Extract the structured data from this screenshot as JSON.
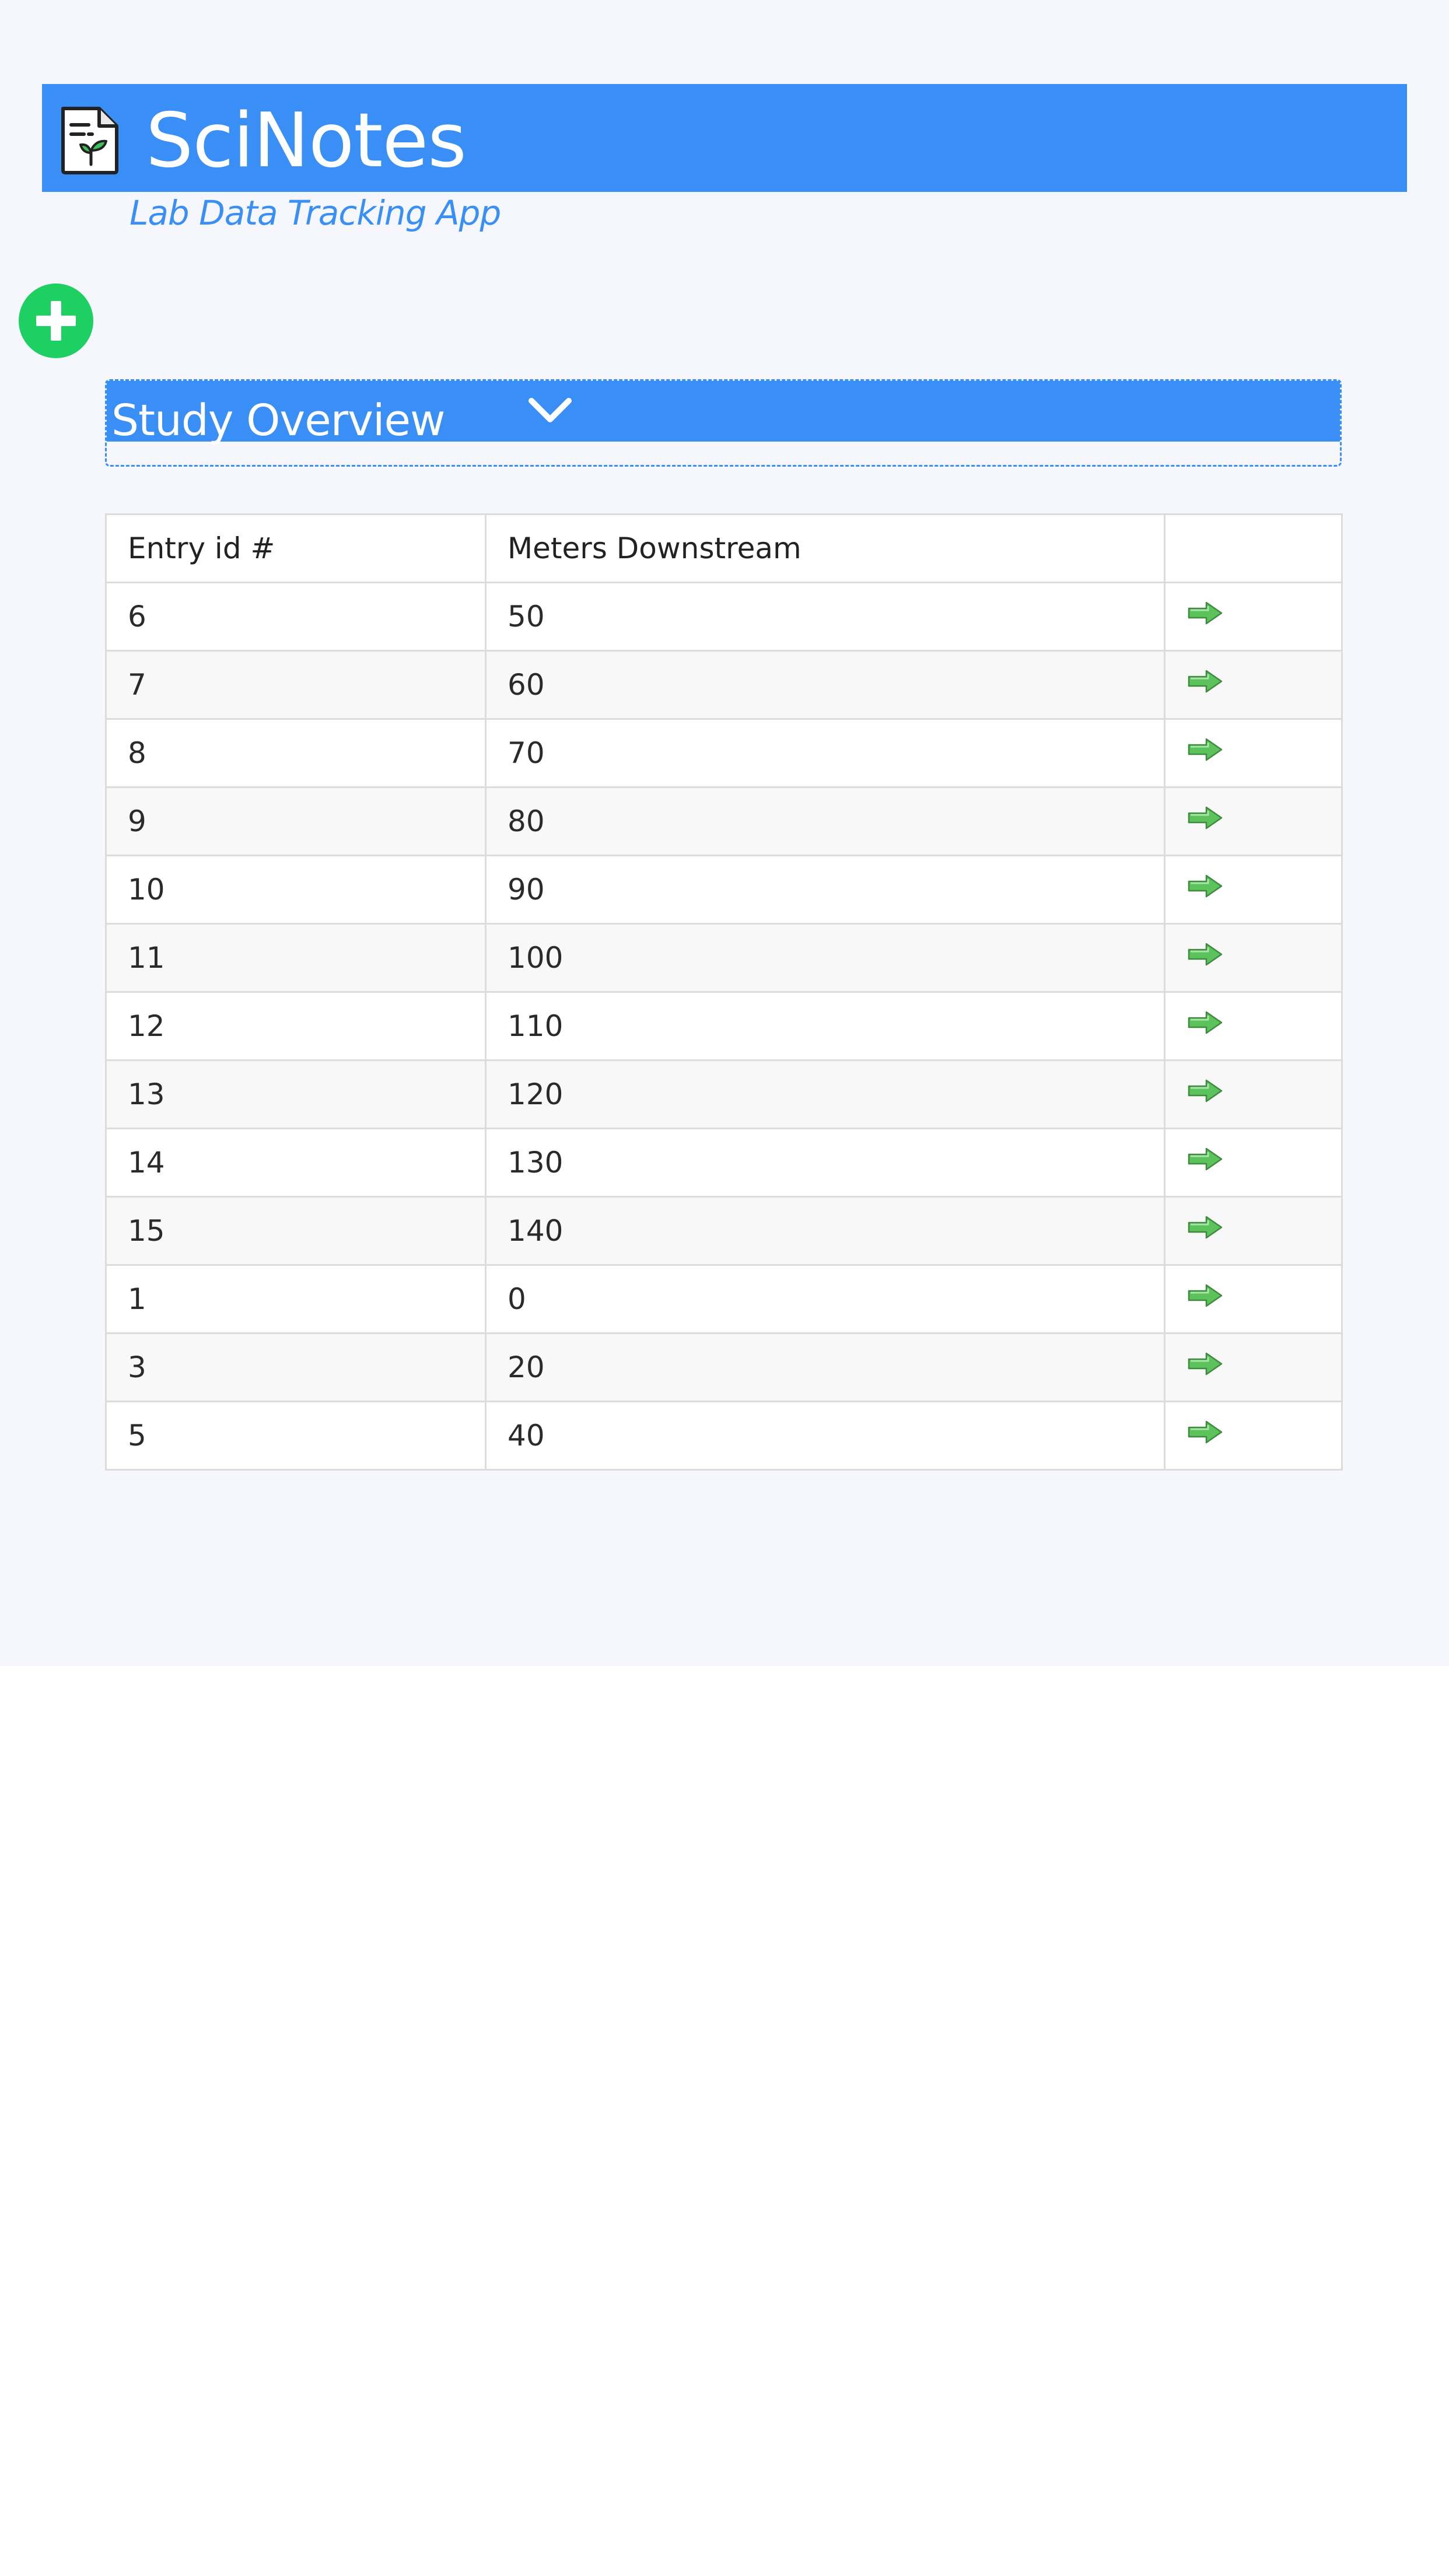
{
  "header": {
    "title": "SciNotes",
    "subtitle": "Lab Data Tracking App",
    "logo_icon": "notebook-sprout-icon"
  },
  "add_button": {
    "icon": "plus-icon",
    "color": "#1ecf62"
  },
  "overview": {
    "title": "Study Overview",
    "icon": "chevron-down-icon"
  },
  "colors": {
    "accent": "#398ff5",
    "background": "#f6f7fc",
    "go_arrow": "#5cc25c"
  },
  "table": {
    "columns": [
      "Entry id #",
      "Meters Downstream",
      ""
    ],
    "row_action_icon": "arrow-right-icon",
    "rows": [
      {
        "entry_id": "6",
        "meters": "50"
      },
      {
        "entry_id": "7",
        "meters": "60"
      },
      {
        "entry_id": "8",
        "meters": "70"
      },
      {
        "entry_id": "9",
        "meters": "80"
      },
      {
        "entry_id": "10",
        "meters": "90"
      },
      {
        "entry_id": "11",
        "meters": "100"
      },
      {
        "entry_id": "12",
        "meters": "110"
      },
      {
        "entry_id": "13",
        "meters": "120"
      },
      {
        "entry_id": "14",
        "meters": "130"
      },
      {
        "entry_id": "15",
        "meters": "140"
      },
      {
        "entry_id": "1",
        "meters": "0"
      },
      {
        "entry_id": "3",
        "meters": "20"
      },
      {
        "entry_id": "5",
        "meters": "40"
      }
    ]
  }
}
